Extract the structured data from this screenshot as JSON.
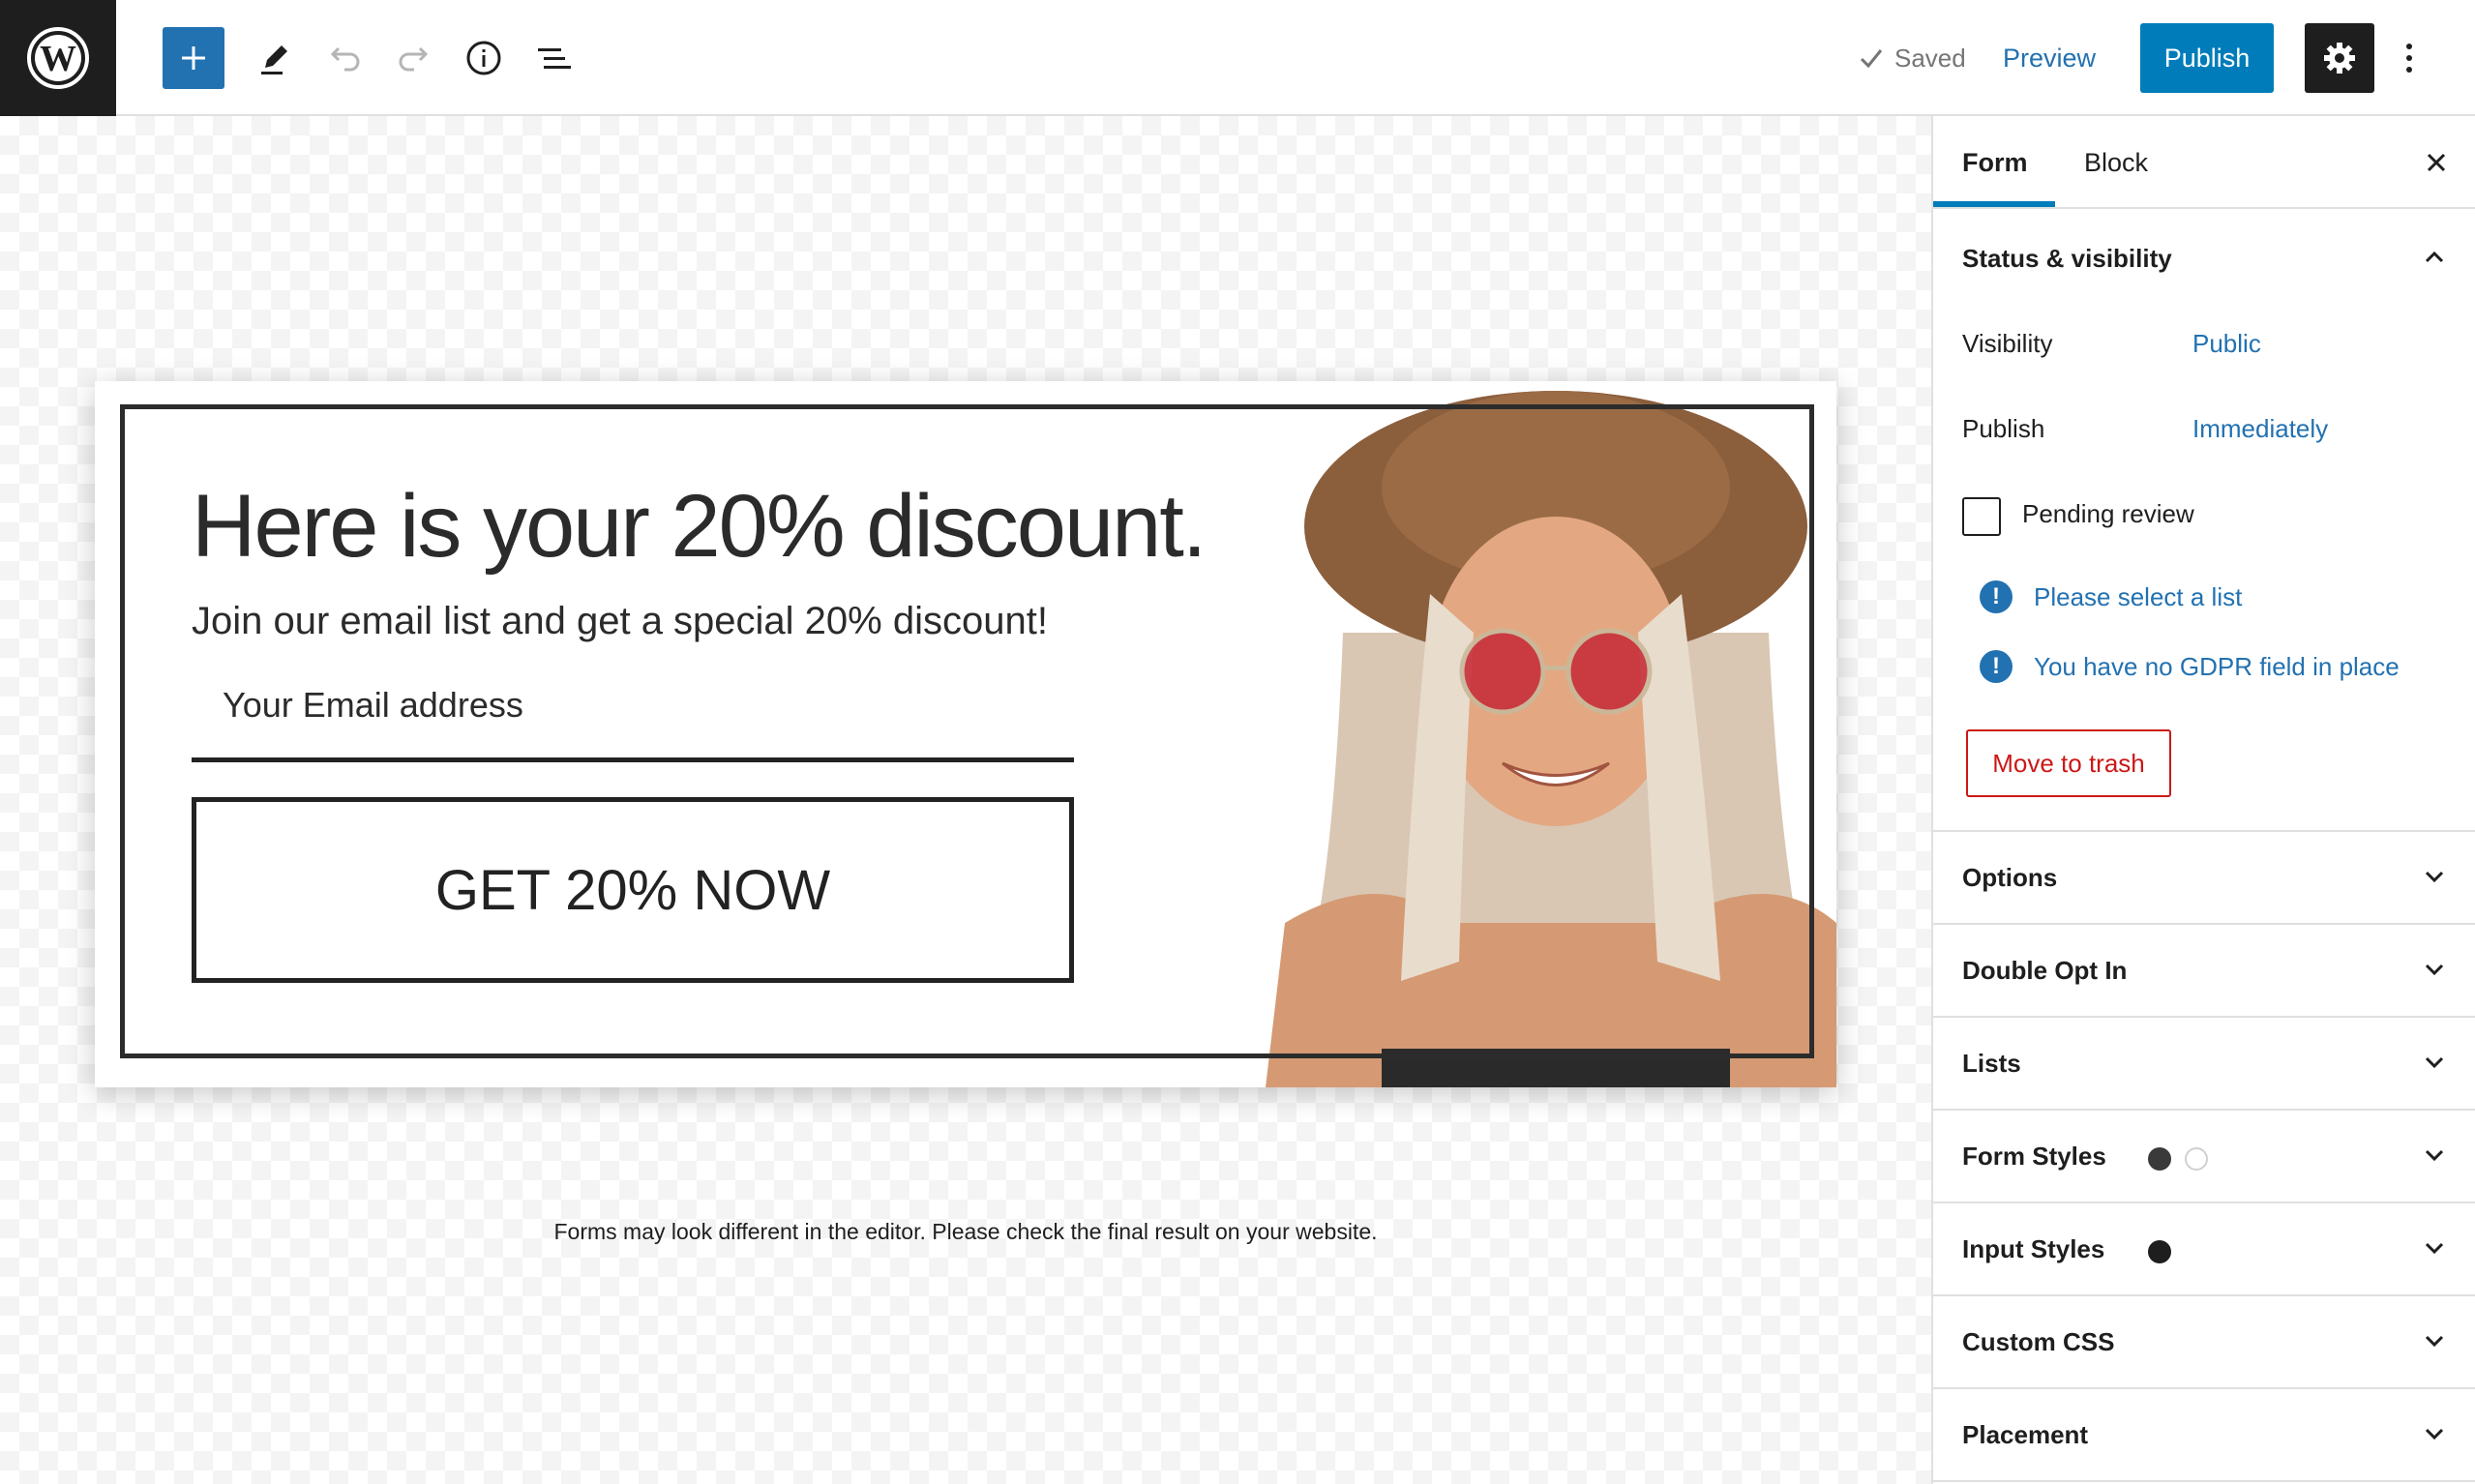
{
  "toolbar": {
    "logo_icon": "wordpress-logo-icon",
    "inserter_icon": "plus-icon",
    "edit_icon": "pencil-icon",
    "undo_icon": "undo-icon",
    "redo_icon": "redo-icon",
    "info_icon": "info-icon",
    "list_view_icon": "list-view-icon",
    "saved_label": "Saved",
    "preview_label": "Preview",
    "publish_label": "Publish",
    "settings_icon": "gear-icon",
    "more_icon": "more-vertical-icon"
  },
  "form": {
    "headline": "Here is your 20% discount.",
    "subline": "Join our email list and get a special 20% discount!",
    "email_placeholder": "Your Email address",
    "cta_label": "GET 20% NOW",
    "image_alt": "woman-in-straw-hat-photo"
  },
  "canvas": {
    "editor_note": "Forms may look different in the editor. Please check the final result on your website."
  },
  "sidebar": {
    "tabs": [
      {
        "label": "Form",
        "active": true
      },
      {
        "label": "Block",
        "active": false
      }
    ],
    "status": {
      "title": "Status & visibility",
      "visibility_label": "Visibility",
      "visibility_value": "Public",
      "publish_label": "Publish",
      "publish_value": "Immediately",
      "pending_label": "Pending review",
      "pending_checked": false,
      "notices": [
        "Please select a list",
        "You have no GDPR field in place"
      ],
      "trash_label": "Move to trash"
    },
    "panels": [
      {
        "title": "Options"
      },
      {
        "title": "Double Opt In"
      },
      {
        "title": "Lists"
      },
      {
        "title": "Form Styles"
      },
      {
        "title": "Input Styles"
      },
      {
        "title": "Custom CSS"
      },
      {
        "title": "Placement"
      }
    ]
  },
  "colors": {
    "accent": "#007cba",
    "link": "#2271b1",
    "danger": "#cc1818",
    "dark": "#1e1e1e"
  }
}
